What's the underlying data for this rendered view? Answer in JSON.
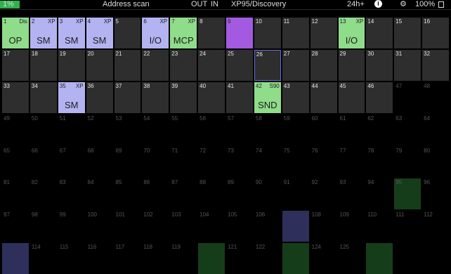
{
  "status_bar": {
    "progress_label": "1%",
    "progress_fraction": 0.01,
    "title": "Address scan",
    "out_label": "OUT",
    "in_label": "IN",
    "protocol": "XP95/Discovery",
    "timer": "24h+",
    "info_icon": "info-icon",
    "info_glyph": "i",
    "settings_icon": "gear-icon",
    "settings_glyph": "⚙",
    "battery": "100%",
    "battery_icon": "battery-icon"
  },
  "colors": {
    "normal": "#2e2e2e",
    "green": "#8fdc8a",
    "blue": "#b3b3f2",
    "purple": "#a45ae0",
    "selected_border": "#6a6ae6",
    "progress": "#2fb24c"
  },
  "cells": [
    {
      "num": "1",
      "state": "green",
      "tag": "Dis",
      "type": "OP"
    },
    {
      "num": "2",
      "state": "blue",
      "tag": "XP",
      "type": "SM"
    },
    {
      "num": "3",
      "state": "blue",
      "tag": "XP",
      "type": "SM"
    },
    {
      "num": "4",
      "state": "blue",
      "tag": "XP",
      "type": "SM"
    },
    {
      "num": "5",
      "state": "normal"
    },
    {
      "num": "6",
      "state": "blue",
      "tag": "XP",
      "type": "I/O"
    },
    {
      "num": "7",
      "state": "green",
      "tag": "XP",
      "type": "MCP"
    },
    {
      "num": "8",
      "state": "normal"
    },
    {
      "num": "9",
      "state": "purple"
    },
    {
      "num": "10",
      "state": "normal"
    },
    {
      "num": "11",
      "state": "normal"
    },
    {
      "num": "12",
      "state": "normal"
    },
    {
      "num": "13",
      "state": "green",
      "tag": "XP",
      "type": "I/O"
    },
    {
      "num": "14",
      "state": "normal"
    },
    {
      "num": "15",
      "state": "normal"
    },
    {
      "num": "16",
      "state": "normal"
    },
    {
      "num": "17",
      "state": "normal"
    },
    {
      "num": "18",
      "state": "normal"
    },
    {
      "num": "19",
      "state": "normal"
    },
    {
      "num": "20",
      "state": "normal"
    },
    {
      "num": "21",
      "state": "normal"
    },
    {
      "num": "22",
      "state": "normal"
    },
    {
      "num": "23",
      "state": "normal"
    },
    {
      "num": "24",
      "state": "normal"
    },
    {
      "num": "25",
      "state": "normal"
    },
    {
      "num": "26",
      "state": "normal",
      "selected": true
    },
    {
      "num": "27",
      "state": "normal"
    },
    {
      "num": "28",
      "state": "normal"
    },
    {
      "num": "29",
      "state": "normal"
    },
    {
      "num": "30",
      "state": "normal"
    },
    {
      "num": "31",
      "state": "normal"
    },
    {
      "num": "32",
      "state": "normal"
    },
    {
      "num": "33",
      "state": "normal"
    },
    {
      "num": "34",
      "state": "normal"
    },
    {
      "num": "35",
      "state": "blue",
      "tag": "XP",
      "type": "SM"
    },
    {
      "num": "36",
      "state": "normal"
    },
    {
      "num": "37",
      "state": "normal"
    },
    {
      "num": "38",
      "state": "normal"
    },
    {
      "num": "39",
      "state": "normal"
    },
    {
      "num": "40",
      "state": "normal"
    },
    {
      "num": "41",
      "state": "normal"
    },
    {
      "num": "42",
      "state": "green",
      "tag": "S90",
      "type": "SND"
    },
    {
      "num": "43",
      "state": "normal"
    },
    {
      "num": "44",
      "state": "normal"
    },
    {
      "num": "45",
      "state": "normal"
    },
    {
      "num": "46",
      "state": "normal"
    },
    {
      "num": "47",
      "state": "dim"
    },
    {
      "num": "48",
      "state": "dim"
    },
    {
      "num": "49",
      "state": "dim"
    },
    {
      "num": "50",
      "state": "dim"
    },
    {
      "num": "51",
      "state": "dim"
    },
    {
      "num": "52",
      "state": "dim"
    },
    {
      "num": "53",
      "state": "dim"
    },
    {
      "num": "54",
      "state": "dim"
    },
    {
      "num": "55",
      "state": "dim"
    },
    {
      "num": "56",
      "state": "dim"
    },
    {
      "num": "57",
      "state": "dim"
    },
    {
      "num": "58",
      "state": "dim"
    },
    {
      "num": "59",
      "state": "dim"
    },
    {
      "num": "60",
      "state": "dim"
    },
    {
      "num": "61",
      "state": "dim"
    },
    {
      "num": "62",
      "state": "dim"
    },
    {
      "num": "63",
      "state": "dim"
    },
    {
      "num": "64",
      "state": "dim"
    },
    {
      "num": "65",
      "state": "dim"
    },
    {
      "num": "66",
      "state": "dim"
    },
    {
      "num": "67",
      "state": "dim"
    },
    {
      "num": "68",
      "state": "dim"
    },
    {
      "num": "69",
      "state": "dim"
    },
    {
      "num": "70",
      "state": "dim"
    },
    {
      "num": "71",
      "state": "dim"
    },
    {
      "num": "72",
      "state": "dim"
    },
    {
      "num": "73",
      "state": "dim"
    },
    {
      "num": "74",
      "state": "dim"
    },
    {
      "num": "75",
      "state": "dim"
    },
    {
      "num": "76",
      "state": "dim"
    },
    {
      "num": "77",
      "state": "dim"
    },
    {
      "num": "78",
      "state": "dim"
    },
    {
      "num": "79",
      "state": "dim"
    },
    {
      "num": "80",
      "state": "dim"
    },
    {
      "num": "81",
      "state": "dim"
    },
    {
      "num": "82",
      "state": "dim"
    },
    {
      "num": "83",
      "state": "dim"
    },
    {
      "num": "84",
      "state": "dim"
    },
    {
      "num": "85",
      "state": "dim"
    },
    {
      "num": "86",
      "state": "dim"
    },
    {
      "num": "87",
      "state": "dim"
    },
    {
      "num": "88",
      "state": "dim"
    },
    {
      "num": "89",
      "state": "dim"
    },
    {
      "num": "90",
      "state": "dim"
    },
    {
      "num": "91",
      "state": "dim"
    },
    {
      "num": "92",
      "state": "dim"
    },
    {
      "num": "93",
      "state": "dim"
    },
    {
      "num": "94",
      "state": "dim"
    },
    {
      "num": "95",
      "state": "dimgreen"
    },
    {
      "num": "96",
      "state": "dim"
    },
    {
      "num": "97",
      "state": "dim"
    },
    {
      "num": "98",
      "state": "dim"
    },
    {
      "num": "99",
      "state": "dim"
    },
    {
      "num": "100",
      "state": "dim"
    },
    {
      "num": "101",
      "state": "dim"
    },
    {
      "num": "102",
      "state": "dim"
    },
    {
      "num": "103",
      "state": "dim"
    },
    {
      "num": "104",
      "state": "dim"
    },
    {
      "num": "105",
      "state": "dim"
    },
    {
      "num": "106",
      "state": "dim"
    },
    {
      "num": "",
      "state": "dimblue"
    },
    {
      "num": "108",
      "state": "dim"
    },
    {
      "num": "109",
      "state": "dim"
    },
    {
      "num": "110",
      "state": "dim"
    },
    {
      "num": "111",
      "state": "dim"
    },
    {
      "num": "112",
      "state": "dim"
    },
    {
      "num": "",
      "state": "dimblue"
    },
    {
      "num": "114",
      "state": "dim"
    },
    {
      "num": "115",
      "state": "dim"
    },
    {
      "num": "116",
      "state": "dim"
    },
    {
      "num": "117",
      "state": "dim"
    },
    {
      "num": "118",
      "state": "dim"
    },
    {
      "num": "119",
      "state": "dim"
    },
    {
      "num": "",
      "state": "dimgreen"
    },
    {
      "num": "121",
      "state": "dim"
    },
    {
      "num": "122",
      "state": "dim"
    },
    {
      "num": "",
      "state": "dimgreen"
    },
    {
      "num": "124",
      "state": "dim"
    },
    {
      "num": "125",
      "state": "dim"
    },
    {
      "num": "",
      "state": "dimgreen"
    },
    {
      "num": "",
      "state": "dim"
    },
    {
      "num": "",
      "state": "dim"
    }
  ]
}
